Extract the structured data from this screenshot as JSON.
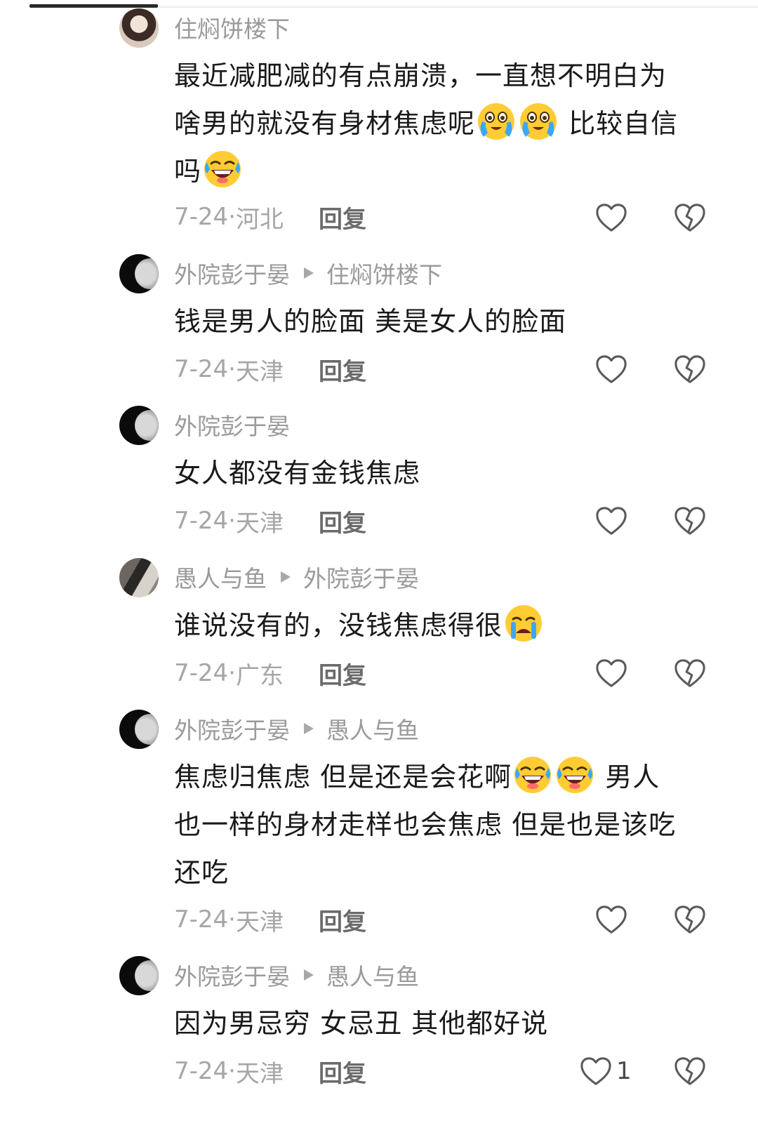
{
  "comments": [
    {
      "author": "住焖饼楼下",
      "reply_to": "",
      "lines": [
        "最近减肥减的有点崩溃，一直想不明白为",
        "啥男的就没有身材焦虑呢",
        "比较自信",
        "吗"
      ],
      "date": "7-24",
      "location": "河北",
      "reply_label": "回复"
    },
    {
      "author": "外院彭于晏",
      "reply_to": "住焖饼楼下",
      "lines": [
        "钱是男人的脸面 美是女人的脸面"
      ],
      "date": "7-24",
      "location": "天津",
      "reply_label": "回复"
    },
    {
      "author": "外院彭于晏",
      "reply_to": "",
      "lines": [
        "女人都没有金钱焦虑"
      ],
      "date": "7-24",
      "location": "天津",
      "reply_label": "回复"
    },
    {
      "author": "愚人与鱼",
      "reply_to": "外院彭于晏",
      "lines": [
        "谁说没有的，没钱焦虑得很"
      ],
      "date": "7-24",
      "location": "广东",
      "reply_label": "回复"
    },
    {
      "author": "外院彭于晏",
      "reply_to": "愚人与鱼",
      "lines": [
        "焦虑归焦虑 但是还是会花啊",
        "男人",
        "也一样的身材走样也会焦虑 但是也是该吃",
        "还吃"
      ],
      "date": "7-24",
      "location": "天津",
      "reply_label": "回复"
    },
    {
      "author": "外院彭于晏",
      "reply_to": "愚人与鱼",
      "lines": [
        "因为男忌穷 女忌丑 其他都好说"
      ],
      "date": "7-24",
      "location": "天津",
      "reply_label": "回复",
      "like_count": "1"
    }
  ],
  "icons": {
    "like": "heart-outline-icon",
    "dislike": "broken-heart-icon",
    "arrow": "reply-arrow-icon",
    "emoji_cry": "loudly-crying-emoji",
    "emoji_laugh": "rolling-laughing-emoji",
    "emoji_sad": "crying-emoji"
  },
  "colors": {
    "name": "#9a9a9a",
    "text": "#1a1a1a",
    "meta": "#a6a6a6",
    "reply": "#6b6b6b"
  }
}
